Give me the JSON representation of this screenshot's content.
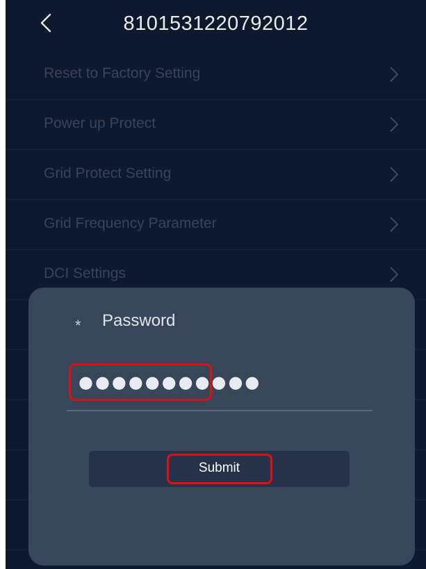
{
  "header": {
    "title": "8101531220792012",
    "back_icon": "chevron-left-icon"
  },
  "menu": {
    "items": [
      {
        "label": "Reset to Factory Setting",
        "icon": "chevron-right-icon"
      },
      {
        "label": "Power up Protect",
        "icon": "chevron-right-icon"
      },
      {
        "label": "Grid Protect Setting",
        "icon": "chevron-right-icon"
      },
      {
        "label": "Grid Frequency Parameter",
        "icon": "chevron-right-icon"
      },
      {
        "label": "DCI Settings",
        "icon": "chevron-right-icon"
      }
    ]
  },
  "dialog": {
    "required_mark": "*",
    "password_label": "Password",
    "password_value": "●●●●●●●●●●●",
    "submit_label": "Submit"
  },
  "colors": {
    "background": "#0f1c33",
    "dialog": "#38465a",
    "button": "#25324a",
    "highlight": "#e01010"
  }
}
